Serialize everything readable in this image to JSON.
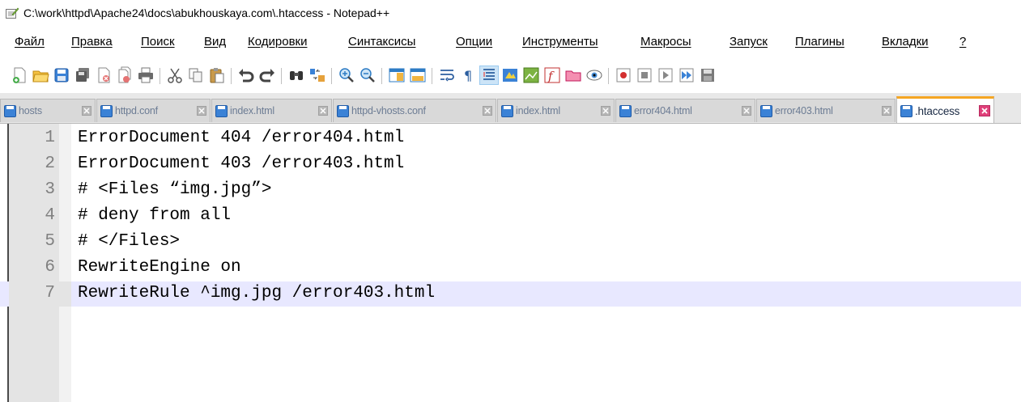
{
  "window": {
    "title": "C:\\work\\httpd\\Apache24\\docs\\abukhouskaya.com\\.htaccess - Notepad++",
    "icon": "notepad-plus-plus-icon"
  },
  "menu": [
    {
      "label": "Файл"
    },
    {
      "label": "Правка"
    },
    {
      "label": "Поиск"
    },
    {
      "label": "Вид"
    },
    {
      "label": "Кодировки"
    },
    {
      "label": "Синтаксисы"
    },
    {
      "label": "Опции"
    },
    {
      "label": "Инструменты"
    },
    {
      "label": "Макросы"
    },
    {
      "label": "Запуск"
    },
    {
      "label": "Плагины"
    },
    {
      "label": "Вкладки"
    },
    {
      "label": "?"
    }
  ],
  "toolbar": {
    "buttons": [
      "new-file-icon",
      "open-file-icon",
      "save-icon",
      "save-all-icon",
      "close-icon",
      "close-all-icon",
      "print-icon",
      "cut-icon",
      "copy-icon",
      "paste-icon",
      "undo-icon",
      "redo-icon",
      "find-icon",
      "replace-icon",
      "zoom-in-icon",
      "zoom-out-icon",
      "sync-vertical-icon",
      "sync-horizontal-icon",
      "word-wrap-icon",
      "show-all-chars-icon",
      "indent-guide-icon",
      "user-defined-language-icon",
      "document-map-icon",
      "function-list-icon",
      "folder-as-workspace-icon",
      "monitoring-icon",
      "record-macro-icon",
      "stop-recording-icon",
      "playback-macro-icon",
      "run-macro-multiple-icon",
      "save-macro-icon"
    ],
    "active": "indent-guide-icon"
  },
  "tabs": [
    {
      "label": "hosts",
      "active": false
    },
    {
      "label": "httpd.conf",
      "active": false
    },
    {
      "label": "index.html",
      "active": false
    },
    {
      "label": "httpd-vhosts.conf",
      "active": false
    },
    {
      "label": "index.html",
      "active": false
    },
    {
      "label": "error404.html",
      "active": false
    },
    {
      "label": "error403.html",
      "active": false
    },
    {
      "label": ".htaccess",
      "active": true
    }
  ],
  "editor": {
    "current_line": 7,
    "lines": [
      {
        "num": "1",
        "text": "ErrorDocument 404 /error404.html"
      },
      {
        "num": "2",
        "text": "ErrorDocument 403 /error403.html"
      },
      {
        "num": "3",
        "text": "# <Files “img.jpg”>"
      },
      {
        "num": "4",
        "text": "# deny from all"
      },
      {
        "num": "5",
        "text": "# </Files>"
      },
      {
        "num": "6",
        "text": "RewriteEngine on"
      },
      {
        "num": "7",
        "text": "RewriteRule ^img.jpg /error403.html"
      }
    ]
  },
  "colors": {
    "active_tab_accent": "#f5a623",
    "current_line_bg": "#e8e8ff",
    "tab_close_active": "#e0407a",
    "save_icon_blue": "#3b82d6"
  }
}
